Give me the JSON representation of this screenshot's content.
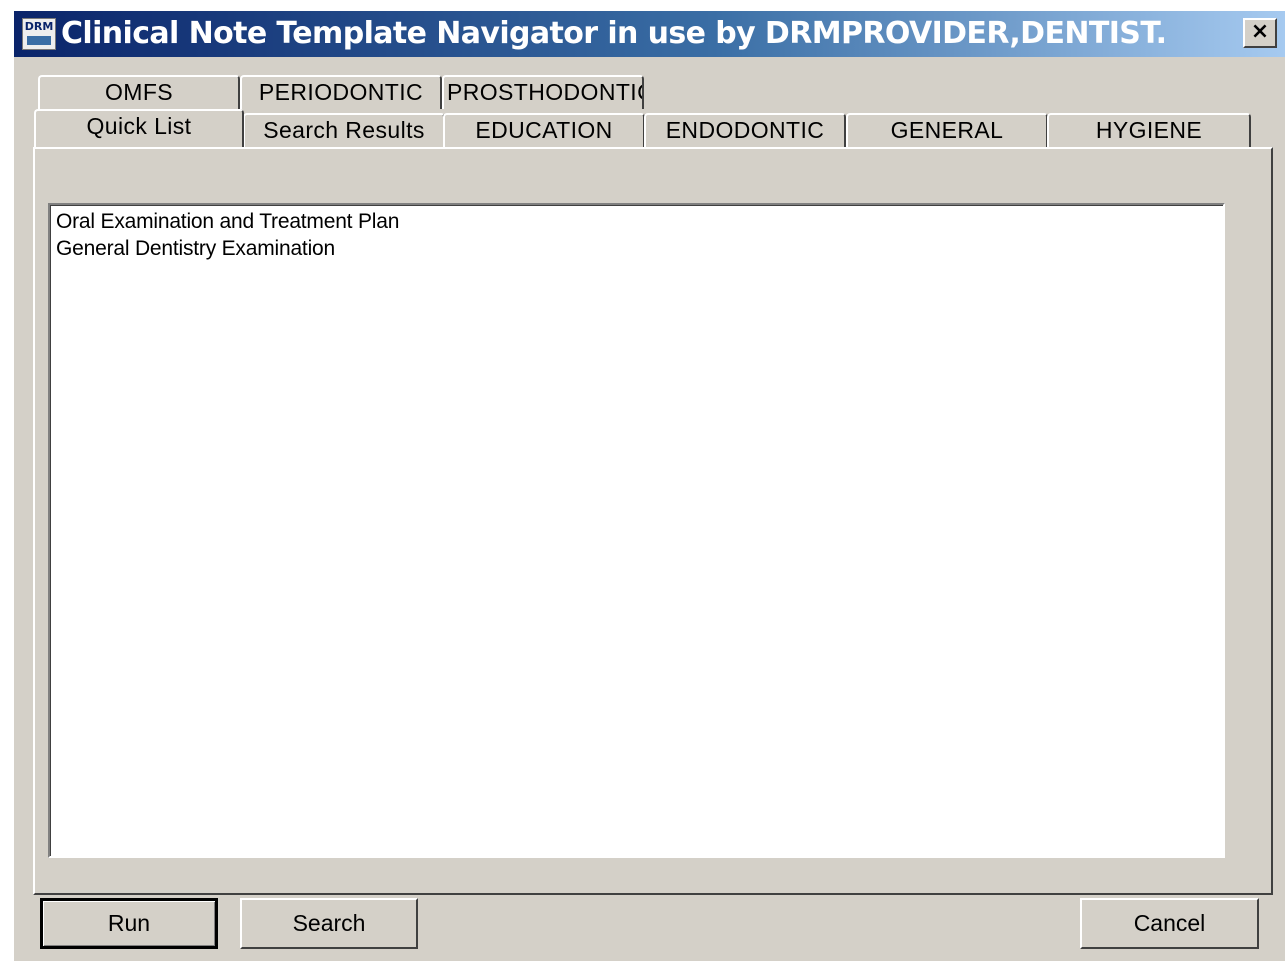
{
  "window": {
    "title": "Clinical Note Template Navigator in use by DRMPROVIDER,DENTIST.",
    "icon_label": "DRM",
    "close_glyph": "×",
    "colors": {
      "titlebar_start": "#0a246a",
      "titlebar_end": "#a6caf0",
      "face": "#d4d0c8"
    }
  },
  "tabs": {
    "back_row": [
      "OMFS",
      "PERIODONTIC",
      "PROSTHODONTICS"
    ],
    "front_row": [
      "Quick List",
      "Search Results",
      "EDUCATION",
      "ENDODONTIC",
      "GENERAL",
      "HYGIENE"
    ],
    "selected": "Quick List"
  },
  "quick_list": {
    "items": [
      "Oral Examination and Treatment Plan",
      "General Dentistry Examination"
    ]
  },
  "buttons": {
    "run": "Run",
    "search": "Search",
    "cancel": "Cancel"
  }
}
